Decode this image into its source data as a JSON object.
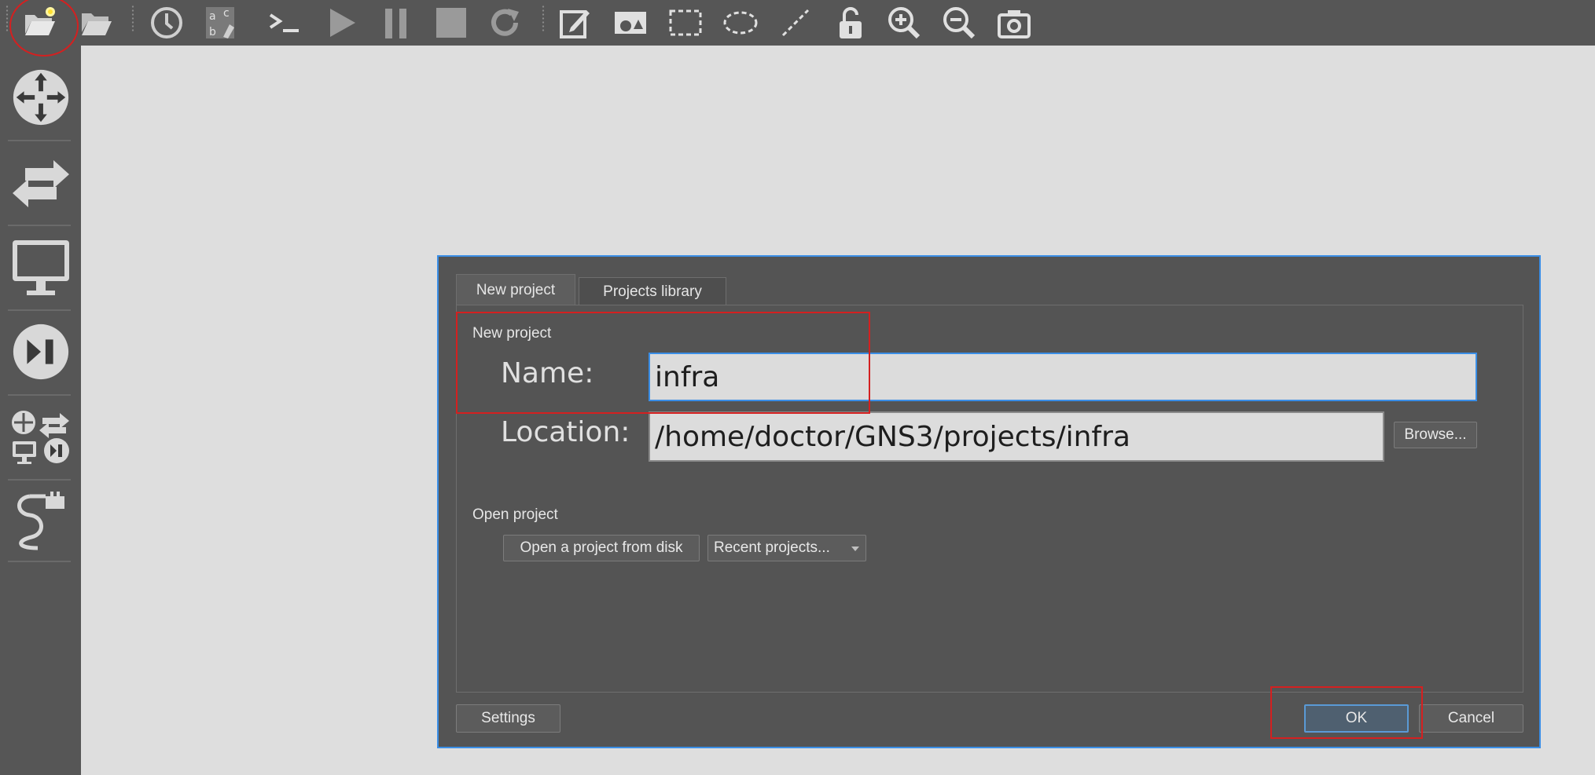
{
  "dialog": {
    "tabs": [
      {
        "label": "New project",
        "active": true
      },
      {
        "label": "Projects library",
        "active": false
      }
    ],
    "new_project": {
      "section_title": "New project",
      "name_label": "Name:",
      "name_value": "infra",
      "location_label": "Location:",
      "location_value": "/home/doctor/GNS3/projects/infra",
      "browse_label": "Browse..."
    },
    "open_project": {
      "section_title": "Open project",
      "open_from_disk_label": "Open a project from disk",
      "recent_projects_label": "Recent projects..."
    },
    "footer": {
      "settings_label": "Settings",
      "ok_label": "OK",
      "cancel_label": "Cancel"
    }
  },
  "toolbar": {
    "icons": [
      "new-project-icon",
      "open-project-icon",
      "snapshot-icon",
      "show-interface-labels-icon",
      "console-icon",
      "start-icon",
      "suspend-icon",
      "stop-icon",
      "reload-icon",
      "add-note-icon",
      "insert-picture-icon",
      "draw-rectangle-icon",
      "draw-ellipse-icon",
      "draw-line-icon",
      "lock-icon",
      "zoom-in-icon",
      "zoom-out-icon",
      "screenshot-icon"
    ]
  },
  "sidebar": {
    "icons": [
      "routers-icon",
      "switches-icon",
      "end-devices-icon",
      "security-devices-icon",
      "all-devices-icon",
      "add-link-icon"
    ]
  },
  "colors": {
    "accent": "#3a8ee6",
    "annotation": "#d42020",
    "panel": "#545454",
    "toolbar": "#565656",
    "canvas": "#dedede"
  }
}
